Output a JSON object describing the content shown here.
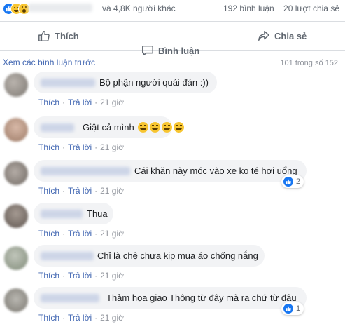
{
  "summary": {
    "others_text": "và 4,8K người khác",
    "comments_count": "192 bình luận",
    "shares_count": "20 lượt chia sẻ"
  },
  "actions": {
    "like": "Thích",
    "comment": "Bình luận",
    "share": "Chia sẻ"
  },
  "comments_header": {
    "more": "Xem các bình luận trước",
    "pager": "101 trong số 152"
  },
  "comment_meta": {
    "like": "Thích",
    "reply": "Trả lời",
    "time": "21 giờ"
  },
  "comments": [
    {
      "text": "Bộ phận người quái đản :))",
      "reactions": ""
    },
    {
      "text": "Giật cả mình",
      "reactions": ""
    },
    {
      "text": "Cái khăn này móc vào xe ko té hơi uổng",
      "reactions": "2"
    },
    {
      "text": "Thua",
      "reactions": ""
    },
    {
      "text": "Chỉ là chệ chưa kịp mua áo chống nắng",
      "reactions": ""
    },
    {
      "text": "Thảm họa giao Thông từ đây mà ra chứ từ đâu",
      "reactions": "1"
    }
  ],
  "colors": {
    "link": "#4267b2",
    "meta_gray": "#90949c",
    "bubble": "#f2f3f5",
    "like_blue": "#1877f2"
  },
  "icons": [
    "thumbs-up-icon",
    "speech-bubble-icon",
    "share-arrow-icon",
    "haha-emoji-icon",
    "wow-emoji-icon"
  ]
}
